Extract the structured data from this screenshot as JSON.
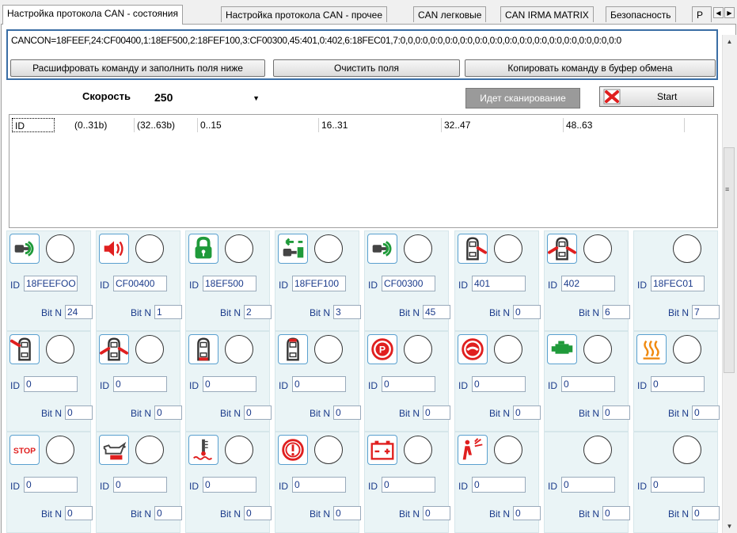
{
  "tabs": [
    {
      "label": "Настройка протокола CAN - состояния",
      "active": true
    },
    {
      "label": "Настройка протокола CAN - прочее",
      "active": false
    },
    {
      "label": "CAN легковые",
      "active": false
    },
    {
      "label": "CAN IRMA MATRIX",
      "active": false
    },
    {
      "label": "Безопасность",
      "active": false
    },
    {
      "label": "P",
      "active": false
    }
  ],
  "command": {
    "text": "CANCON=18FEEF,24:CF00400,1:18EF500,2:18FEF100,3:CF00300,45:401,0:402,6:18FEC01,7:0,0,0:0,0:0,0:0,0:0,0:0,0:0,0:0,0:0,0:0,0:0,0:0,0:0,0:0,0:0",
    "decode_label": "Расшифровать команду и заполнить поля ниже",
    "clear_label": "Очистить поля",
    "copy_label": "Копировать команду в буфер обмена"
  },
  "speed": {
    "label": "Скорость",
    "value": "250"
  },
  "status_label": "Идет сканирование",
  "start_label": "Start",
  "table_headers": [
    "ID",
    "(0..31b)",
    "(32..63b)",
    "0..15",
    "16..31",
    "32..47",
    "48..63"
  ],
  "cells": [
    {
      "icon": "key-signal-icon",
      "id": "18FEEFOO",
      "bit": "24"
    },
    {
      "icon": "horn-icon",
      "id": "CF00400",
      "bit": "1"
    },
    {
      "icon": "padlock-icon",
      "id": "18EF500",
      "bit": "2"
    },
    {
      "icon": "key-arrow-icon",
      "id": "18FEF100",
      "bit": "3"
    },
    {
      "icon": "key-signal-icon",
      "id": "CF00300",
      "bit": "45"
    },
    {
      "icon": "car-door-right-icon",
      "id": "401",
      "bit": "0"
    },
    {
      "icon": "car-doors-open-icon",
      "id": "402",
      "bit": "6"
    },
    {
      "icon": "",
      "id": "18FEC01",
      "bit": "7"
    },
    {
      "icon": "car-door-left-icon",
      "id": "0",
      "bit": "0"
    },
    {
      "icon": "car-doors-open-icon",
      "id": "0",
      "bit": "0"
    },
    {
      "icon": "car-trunk-icon",
      "id": "0",
      "bit": "0"
    },
    {
      "icon": "car-hood-icon",
      "id": "0",
      "bit": "0"
    },
    {
      "icon": "parking-brake-icon",
      "id": "0",
      "bit": "0"
    },
    {
      "icon": "brake-warning-icon",
      "id": "0",
      "bit": "0"
    },
    {
      "icon": "engine-icon",
      "id": "0",
      "bit": "0"
    },
    {
      "icon": "heater-icon",
      "id": "0",
      "bit": "0"
    },
    {
      "icon": "stop-icon",
      "id": "0",
      "bit": "0"
    },
    {
      "icon": "oil-can-icon",
      "id": "0",
      "bit": "0"
    },
    {
      "icon": "coolant-temp-icon",
      "id": "0",
      "bit": "0"
    },
    {
      "icon": "warning-circle-icon",
      "id": "0",
      "bit": "0"
    },
    {
      "icon": "battery-icon",
      "id": "0",
      "bit": "0"
    },
    {
      "icon": "airbag-icon",
      "id": "0",
      "bit": "0"
    },
    {
      "icon": "",
      "id": "0",
      "bit": "0"
    },
    {
      "icon": "",
      "id": "0",
      "bit": "0"
    }
  ],
  "labels": {
    "id": "ID",
    "bit": "Bit N",
    "stop_text": "STOP"
  },
  "colors": {
    "accent": "#3a6ea5",
    "cell_bg": "#eaf4f6",
    "icon_green": "#1f9a3a",
    "icon_red": "#e01f1f",
    "icon_orange": "#f08a10"
  }
}
